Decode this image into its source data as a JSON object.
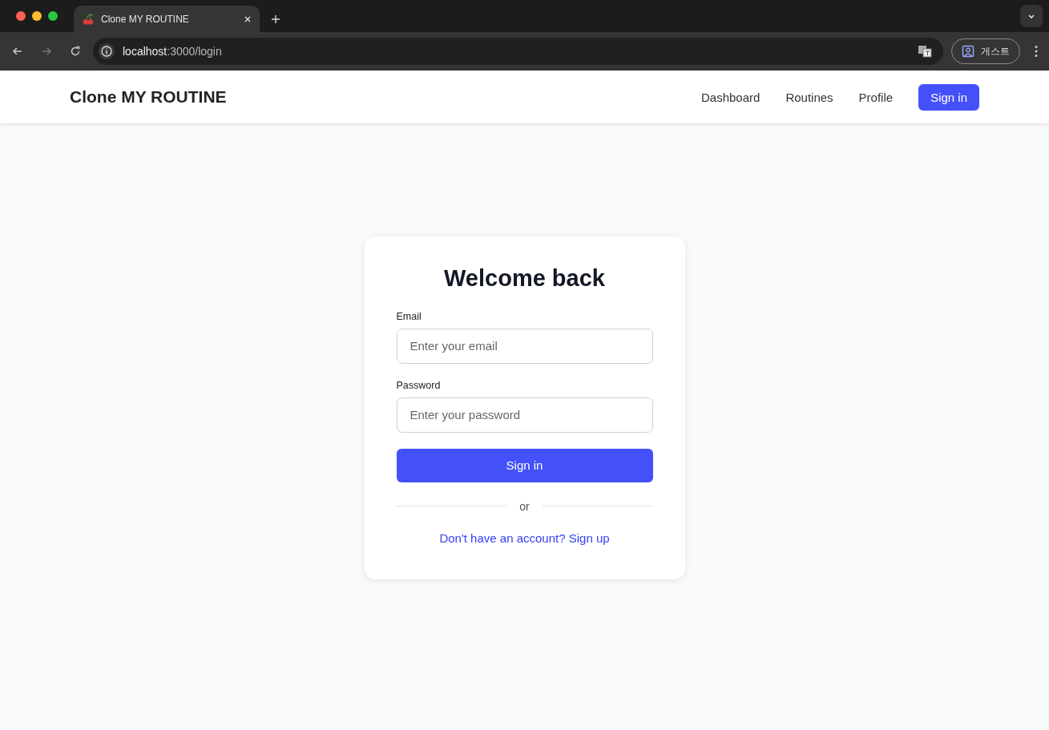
{
  "browser": {
    "tab_title": "Clone MY ROUTINE",
    "url_host": "localhost",
    "url_rest": ":3000/login",
    "profile_label": "게스트"
  },
  "header": {
    "brand": "Clone MY ROUTINE",
    "nav": [
      "Dashboard",
      "Routines",
      "Profile"
    ],
    "sign_in": "Sign in"
  },
  "card": {
    "title": "Welcome back",
    "fields": [
      {
        "label": "Email",
        "placeholder": "Enter your email"
      },
      {
        "label": "Password",
        "placeholder": "Enter your password"
      }
    ],
    "submit": "Sign in",
    "divider": "or",
    "signup_link": "Don't have an account? Sign up"
  }
}
